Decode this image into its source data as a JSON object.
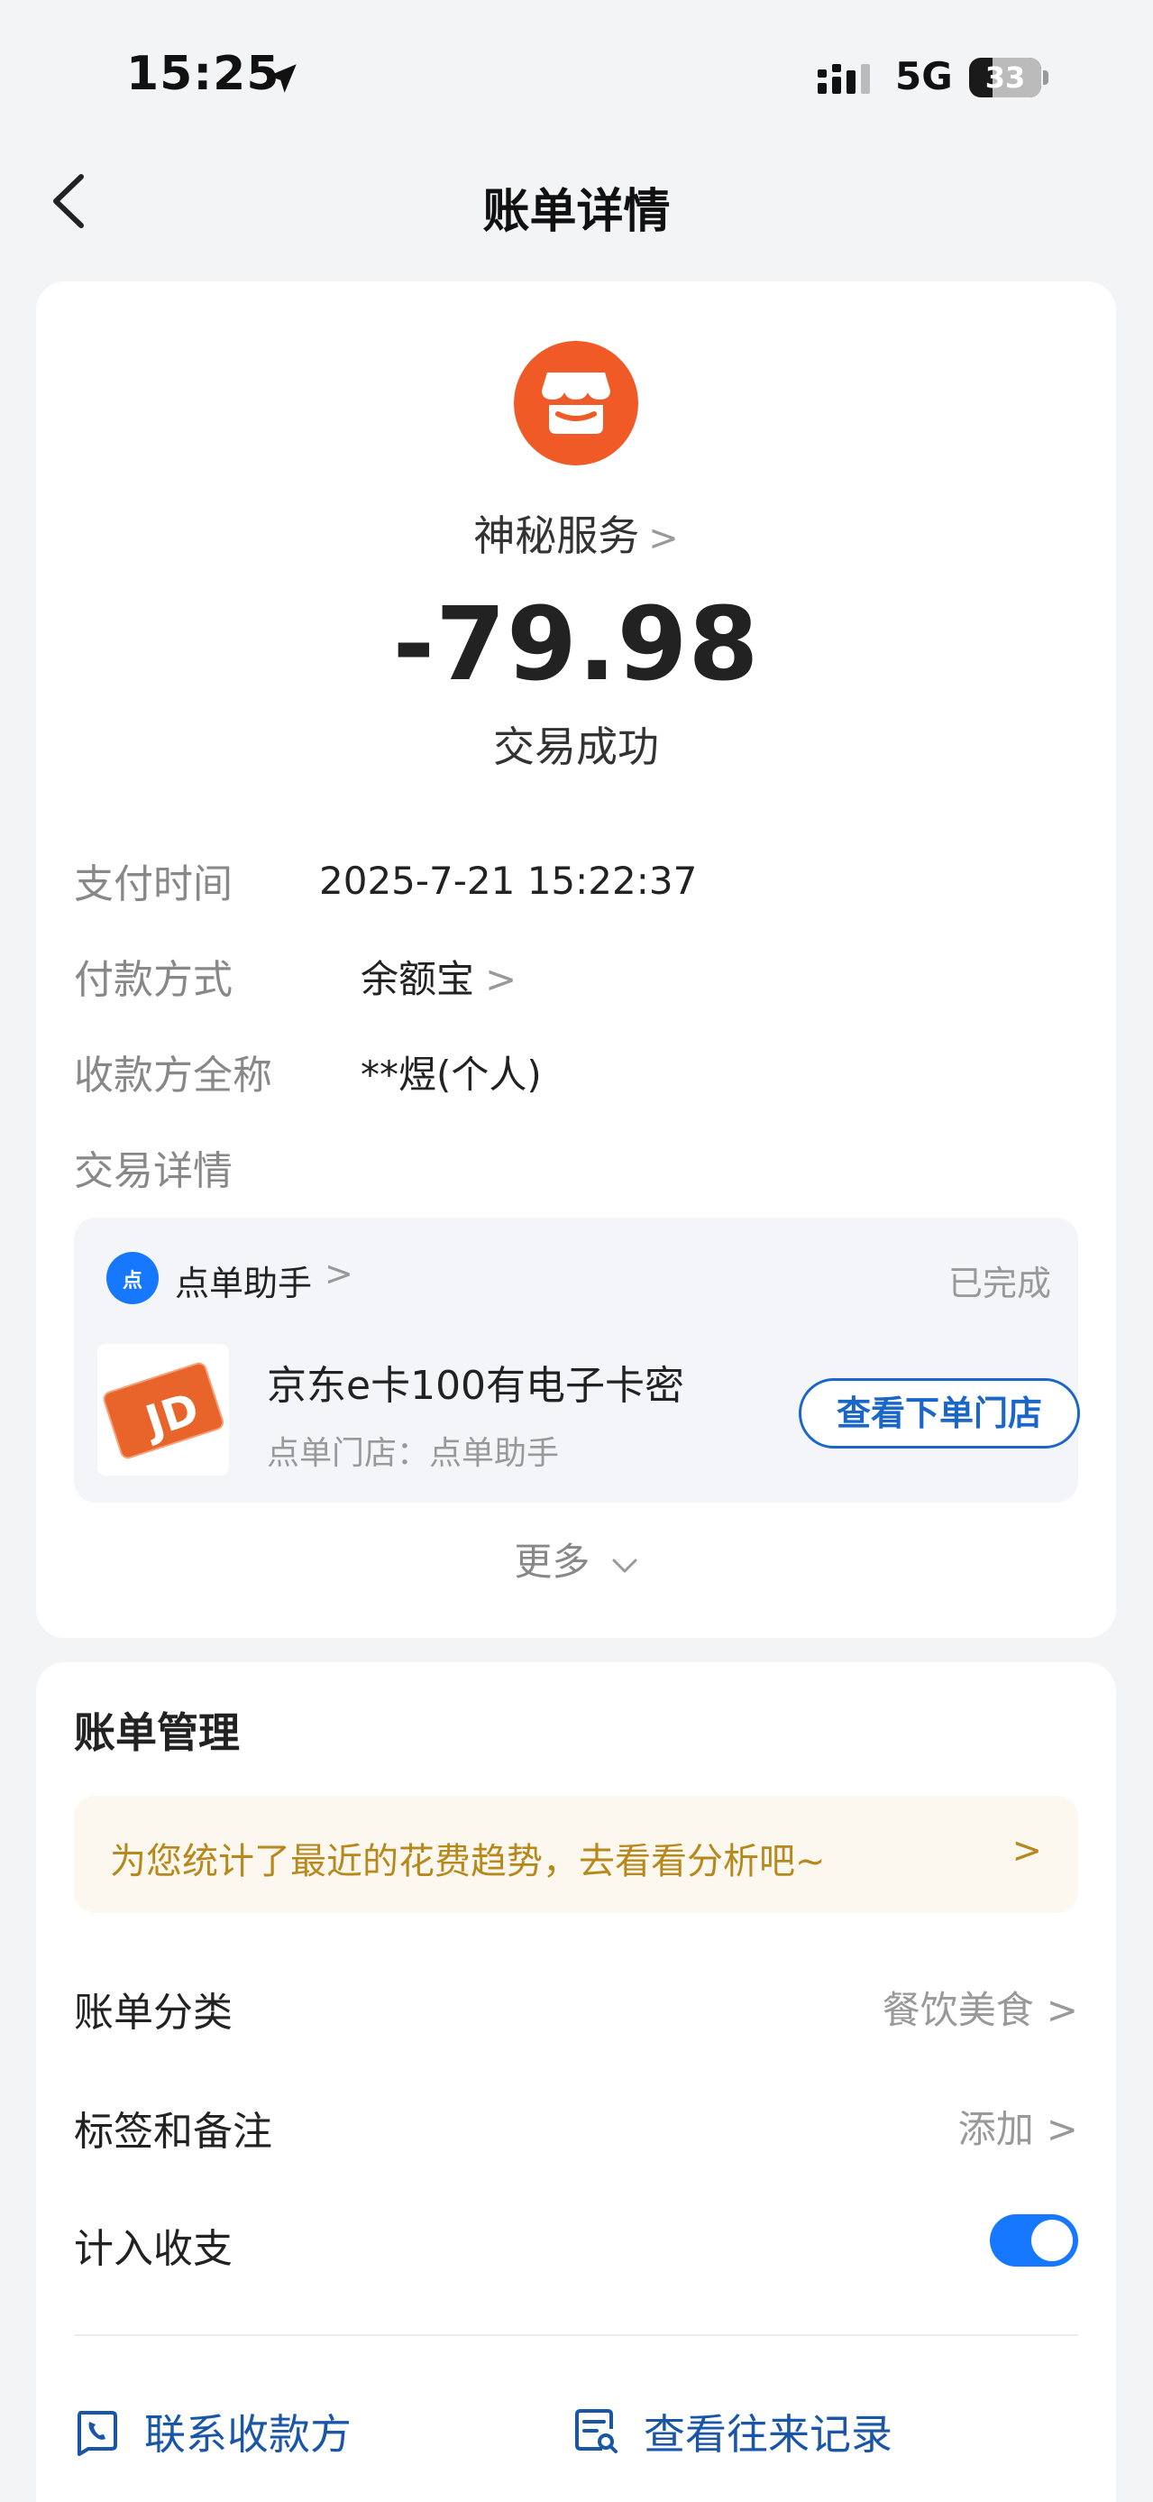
{
  "status_bar": {
    "time": "15:25",
    "network": "5G",
    "battery": "33",
    "battery_level": 0.33
  },
  "nav": {
    "title": "账单详情"
  },
  "transaction": {
    "merchant_name": "神秘服务",
    "amount": "-79.98",
    "status": "交易成功",
    "rows": [
      {
        "label": "支付时间",
        "value": "2025-7-21 15:22:37"
      },
      {
        "label": "付款方式",
        "value": "余额宝"
      },
      {
        "label": "收款方全称",
        "value": "**煜(个人)"
      },
      {
        "label": "交易详情",
        "value": ""
      }
    ]
  },
  "order": {
    "assistant_name": "点单助手",
    "status": "已完成",
    "product_title": "京东e卡100有电子卡密",
    "store_line": "点单门店：点单助手",
    "view_store_label": "查看下单门店",
    "more_label": "更多"
  },
  "bill_manage": {
    "title": "账单管理",
    "insight": "为您统计了最近的花费趋势，去看看分析吧~",
    "category_label": "账单分类",
    "category_value": "餐饮美食",
    "tags_label": "标签和备注",
    "tags_value": "添加",
    "include_label": "计入收支",
    "include_on": true,
    "contact_label": "联系收款方",
    "history_label": "查看往来记录"
  },
  "colors": {
    "accent_blue": "#1677ff",
    "merchant_orange": "#ef5a26",
    "insight_gold": "#b7891d"
  }
}
